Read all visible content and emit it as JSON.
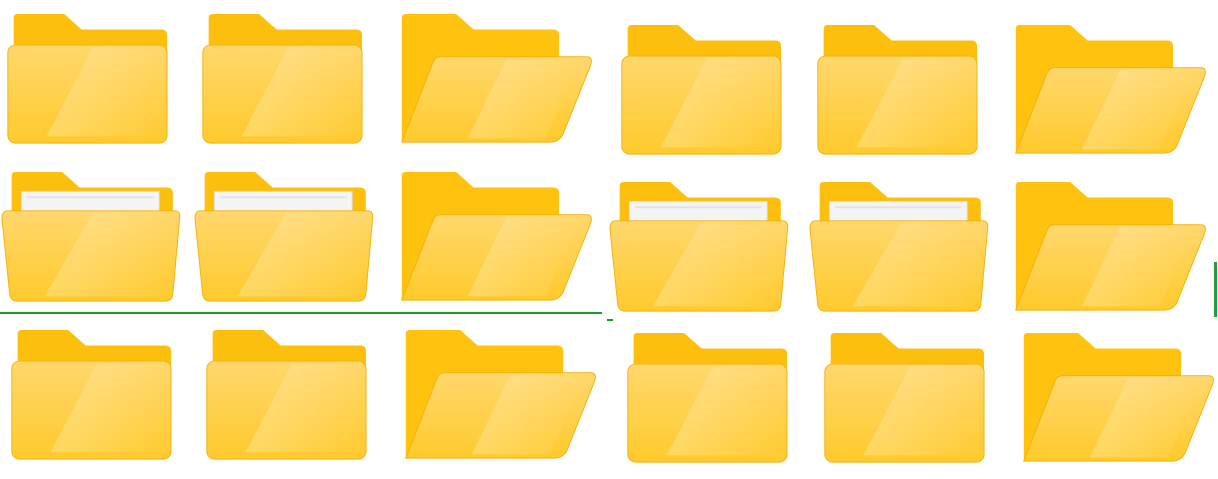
{
  "palette": {
    "tab": "#fcbf0d",
    "back": "#ffc20f",
    "front_top": "#ffd76d",
    "front_bottom": "#ffca2c",
    "edge": "#f2b10c",
    "paper": "#f4f4f4",
    "paper_edge": "#d9d9d9",
    "divider": "#1f9b1f"
  },
  "folders": [
    {
      "icon": "folder-closed-icon"
    },
    {
      "icon": "folder-closed-icon"
    },
    {
      "icon": "folder-open-icon"
    },
    {
      "icon": "folder-closed-icon"
    },
    {
      "icon": "folder-closed-icon"
    },
    {
      "icon": "folder-open-icon"
    },
    {
      "icon": "folder-with-documents-icon"
    },
    {
      "icon": "folder-with-documents-icon"
    },
    {
      "icon": "folder-open-icon"
    },
    {
      "icon": "folder-with-documents-icon"
    },
    {
      "icon": "folder-with-documents-icon"
    },
    {
      "icon": "folder-open-icon"
    },
    {
      "icon": "folder-closed-icon"
    },
    {
      "icon": "folder-closed-icon"
    },
    {
      "icon": "folder-open-icon"
    },
    {
      "icon": "folder-closed-icon"
    },
    {
      "icon": "folder-closed-icon"
    },
    {
      "icon": "folder-open-icon"
    }
  ]
}
